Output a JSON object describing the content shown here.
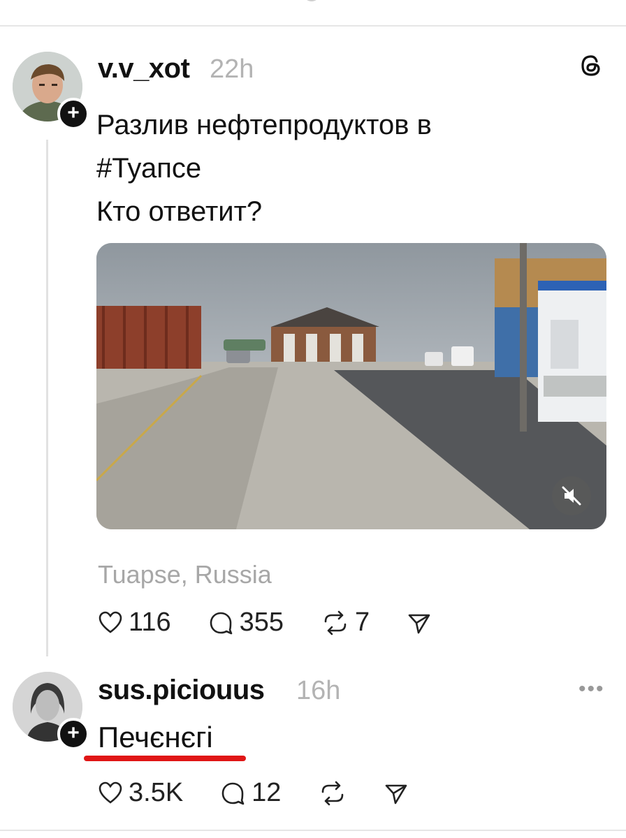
{
  "post": {
    "username": "v.v_xot",
    "time": "22h",
    "text_lines": [
      "Разлив нефтепродуктов в",
      "#Туапсе",
      "Кто ответит?"
    ],
    "location": "Tuapse, Russia",
    "likes": "116",
    "comments": "355",
    "reposts": "7"
  },
  "reply": {
    "username": "sus.piciouus",
    "time": "16h",
    "text": "Печєнєгі",
    "likes": "3.5K",
    "comments": "12"
  },
  "icons": {
    "threads": "threads-logo-icon",
    "like": "heart-icon",
    "comment": "comment-icon",
    "repost": "repost-icon",
    "share": "share-icon",
    "mute": "muted-speaker-icon",
    "more": "more-icon",
    "follow": "plus-icon"
  },
  "colors": {
    "accent_underline": "#e01616",
    "muted_text": "#a7a7a7"
  }
}
